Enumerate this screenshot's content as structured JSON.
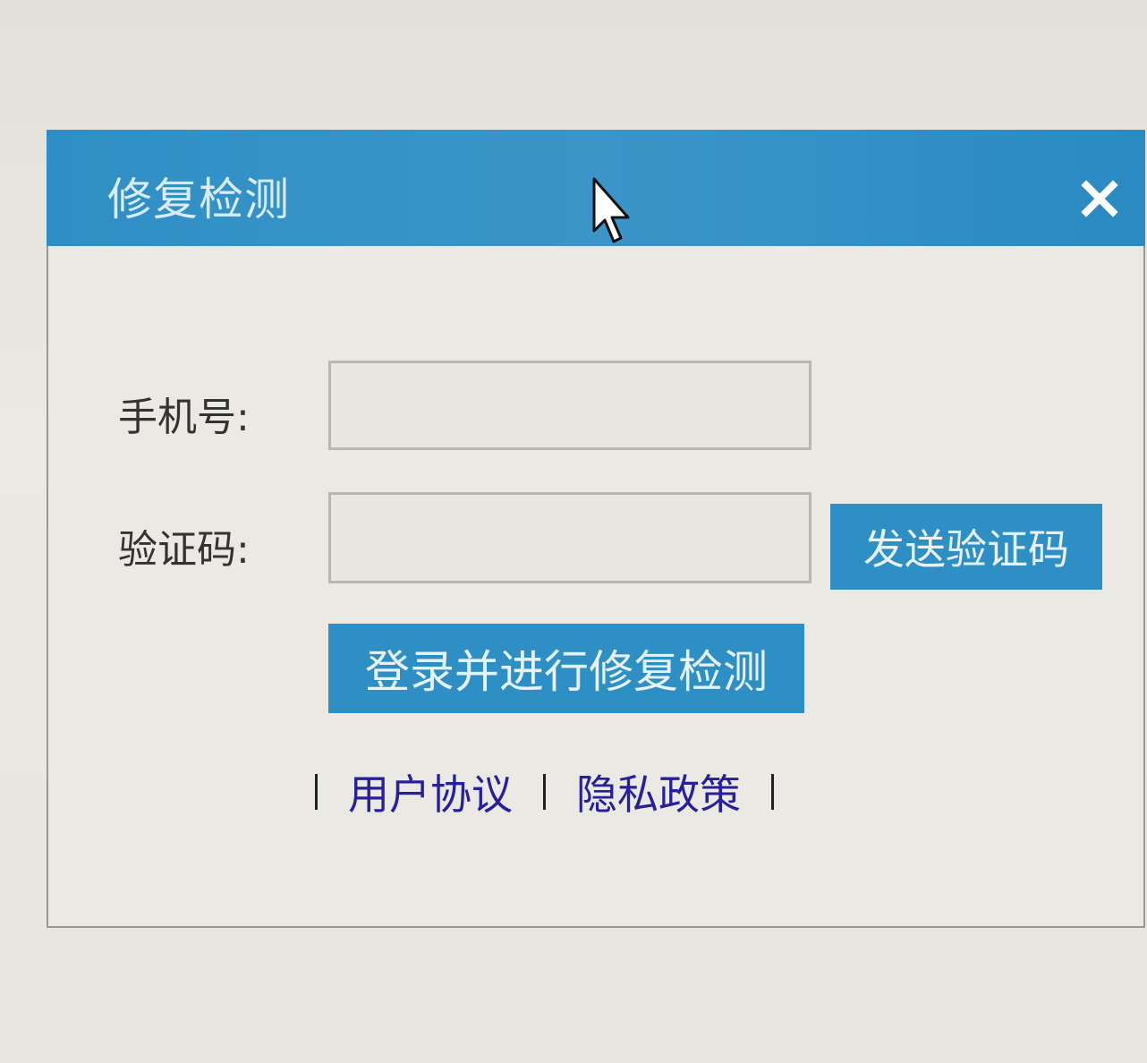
{
  "dialog": {
    "title": "修复检测",
    "close_icon": "close-icon"
  },
  "form": {
    "phone_label": "手机号:",
    "phone_value": "",
    "code_label": "验证码:",
    "code_value": "",
    "send_code_label": "发送验证码",
    "login_label": "登录并进行修复检测"
  },
  "links": {
    "user_agreement": "用户协议",
    "privacy_policy": "隐私政策"
  },
  "colors": {
    "accent": "#2e8fc4",
    "link": "#27209a"
  }
}
